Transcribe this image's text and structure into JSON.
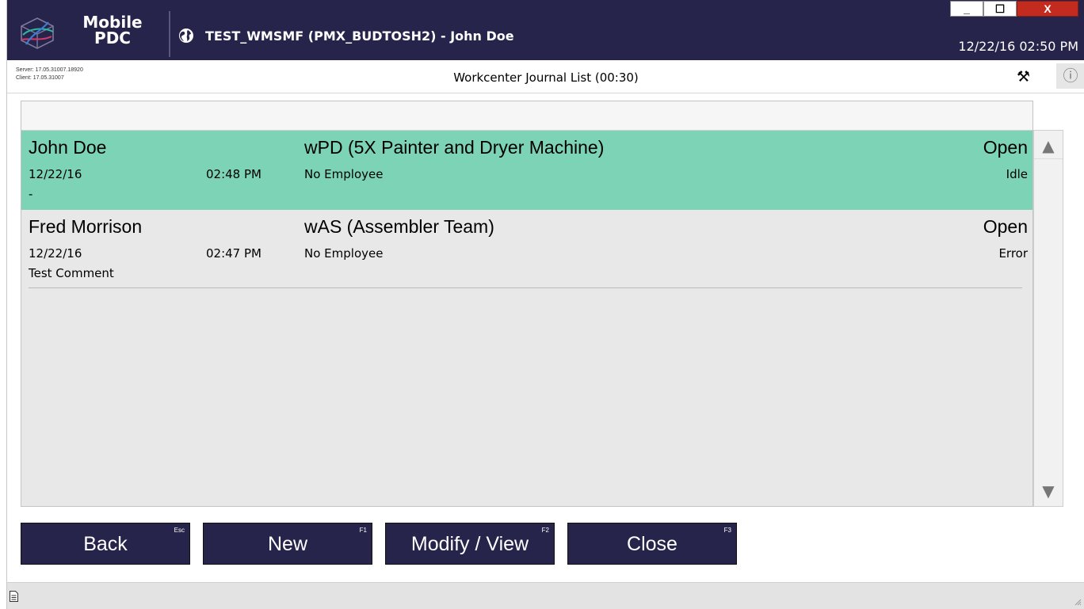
{
  "titlebar": {
    "app_name_line1": "Mobile",
    "app_name_line2": "PDC",
    "window_title": "TEST_WMSMF (PMX_BUDTOSH2) - John Doe",
    "datetime": "12/22/16 02:50 PM",
    "minimize_label": "_",
    "maximize_label": "☐",
    "close_label": "X",
    "background_color": "#26244a"
  },
  "info": {
    "server_version": "Server: 17.05.31007.18920",
    "client_version": "Client: 17.05.31007",
    "page_title": "Workcenter Journal List (00:30)",
    "tools_icon": "tools-icon",
    "info_icon": "info-icon",
    "info_glyph": "ⓘ",
    "tools_glyph": "⚒"
  },
  "journal": {
    "rows": [
      {
        "employee": "John Doe",
        "date": "12/22/16",
        "time": "02:48 PM",
        "comment": "-",
        "workcenter": "wPD (5X Painter and Dryer Machine)",
        "workcenter_employee": "No Employee",
        "status": "Open",
        "substatus": "Idle",
        "selected": true,
        "highlight_color": "#7dd3b5"
      },
      {
        "employee": "Fred Morrison",
        "date": "12/22/16",
        "time": "02:47 PM",
        "comment": "Test Comment",
        "workcenter": "wAS (Assembler Team)",
        "workcenter_employee": "No Employee",
        "status": "Open",
        "substatus": "Error",
        "selected": false
      }
    ]
  },
  "scrollbar": {
    "up_glyph": "▲",
    "down_glyph": "▼"
  },
  "actions": {
    "back": {
      "label": "Back",
      "hotkey": "Esc"
    },
    "new": {
      "label": "New",
      "hotkey": "F1"
    },
    "modify": {
      "label": "Modify / View",
      "hotkey": "F2"
    },
    "close": {
      "label": "Close",
      "hotkey": "F3"
    },
    "background_color": "#26244a"
  }
}
